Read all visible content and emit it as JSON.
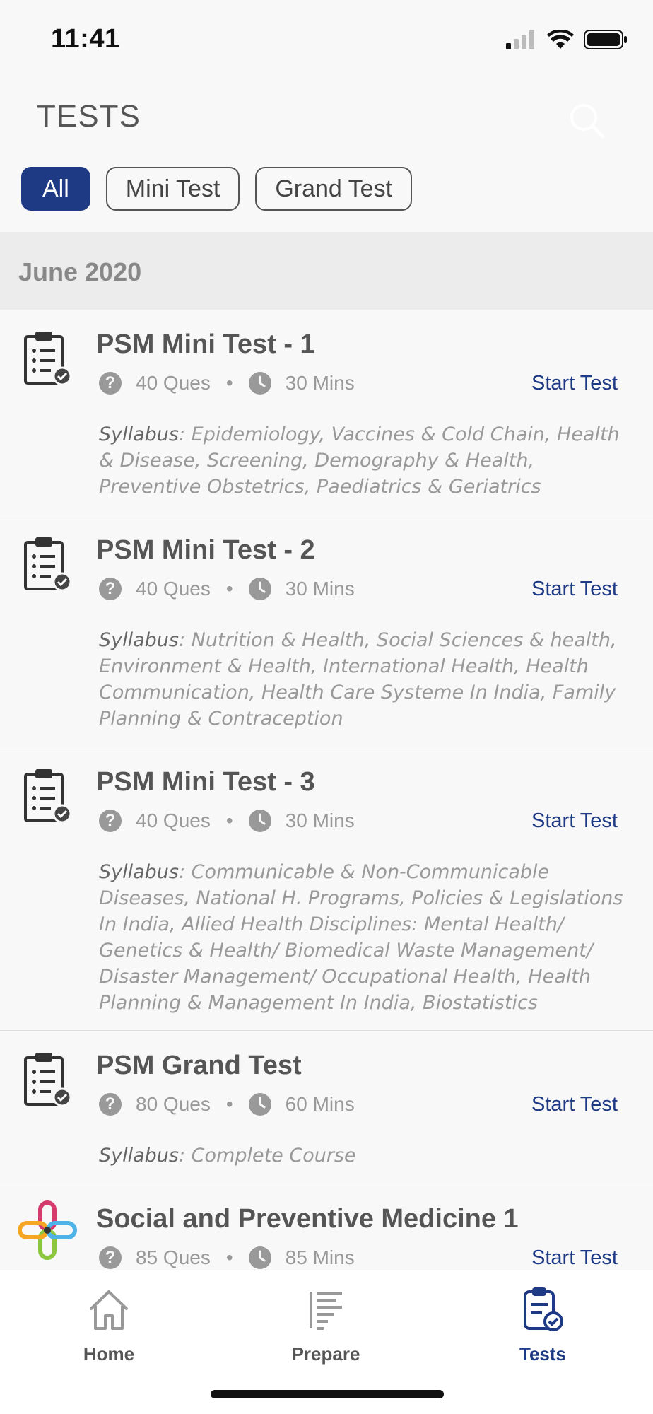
{
  "status_bar": {
    "time": "11:41"
  },
  "header": {
    "title": "TESTS",
    "search_icon": "search-icon"
  },
  "filters": [
    {
      "label": "All",
      "active": true
    },
    {
      "label": "Mini Test",
      "active": false
    },
    {
      "label": "Grand Test",
      "active": false
    }
  ],
  "section": {
    "title": "June 2020"
  },
  "tests": [
    {
      "title": "PSM Mini Test - 1",
      "questions": "40 Ques",
      "duration": "30 Mins",
      "action": "Start Test",
      "syllabus_label": "Syllabus",
      "syllabus": ": Epidemiology, Vaccines & Cold Chain, Health & Disease, Screening, Demography & Health, Preventive Obstetrics, Paediatrics & Geriatrics"
    },
    {
      "title": "PSM Mini Test - 2",
      "questions": "40 Ques",
      "duration": "30 Mins",
      "action": "Start Test",
      "syllabus_label": "Syllabus",
      "syllabus": ": Nutrition & Health, Social Sciences & health, Environment & Health, International Health, Health Communication, Health Care Systeme In India, Family Planning & Contraception"
    },
    {
      "title": "PSM Mini Test - 3",
      "questions": "40 Ques",
      "duration": "30 Mins",
      "action": "Start Test",
      "syllabus_label": "Syllabus",
      "syllabus": ": Communicable & Non-Communicable Diseases, National H. Programs, Policies & Legislations In India, Allied Health Disciplines: Mental Health/ Genetics & Health/ Biomedical Waste Management/ Disaster Management/ Occupational Health, Health Planning & Management In India, Biostatistics"
    },
    {
      "title": "PSM Grand Test",
      "questions": "80 Ques",
      "duration": "60 Mins",
      "action": "Start Test",
      "syllabus_label": "Syllabus",
      "syllabus": ": Complete Course"
    },
    {
      "title": "Social and Preventive Medicine 1",
      "questions": "85 Ques",
      "duration": "85 Mins",
      "action": "Start Test"
    }
  ],
  "bottom_nav": [
    {
      "label": "Home",
      "icon": "home-icon",
      "active": false
    },
    {
      "label": "Prepare",
      "icon": "prepare-icon",
      "active": false
    },
    {
      "label": "Tests",
      "icon": "tests-icon",
      "active": true
    }
  ],
  "colors": {
    "accent": "#1f3a84",
    "background": "#f8f8f8",
    "section_bg": "#ececec"
  }
}
